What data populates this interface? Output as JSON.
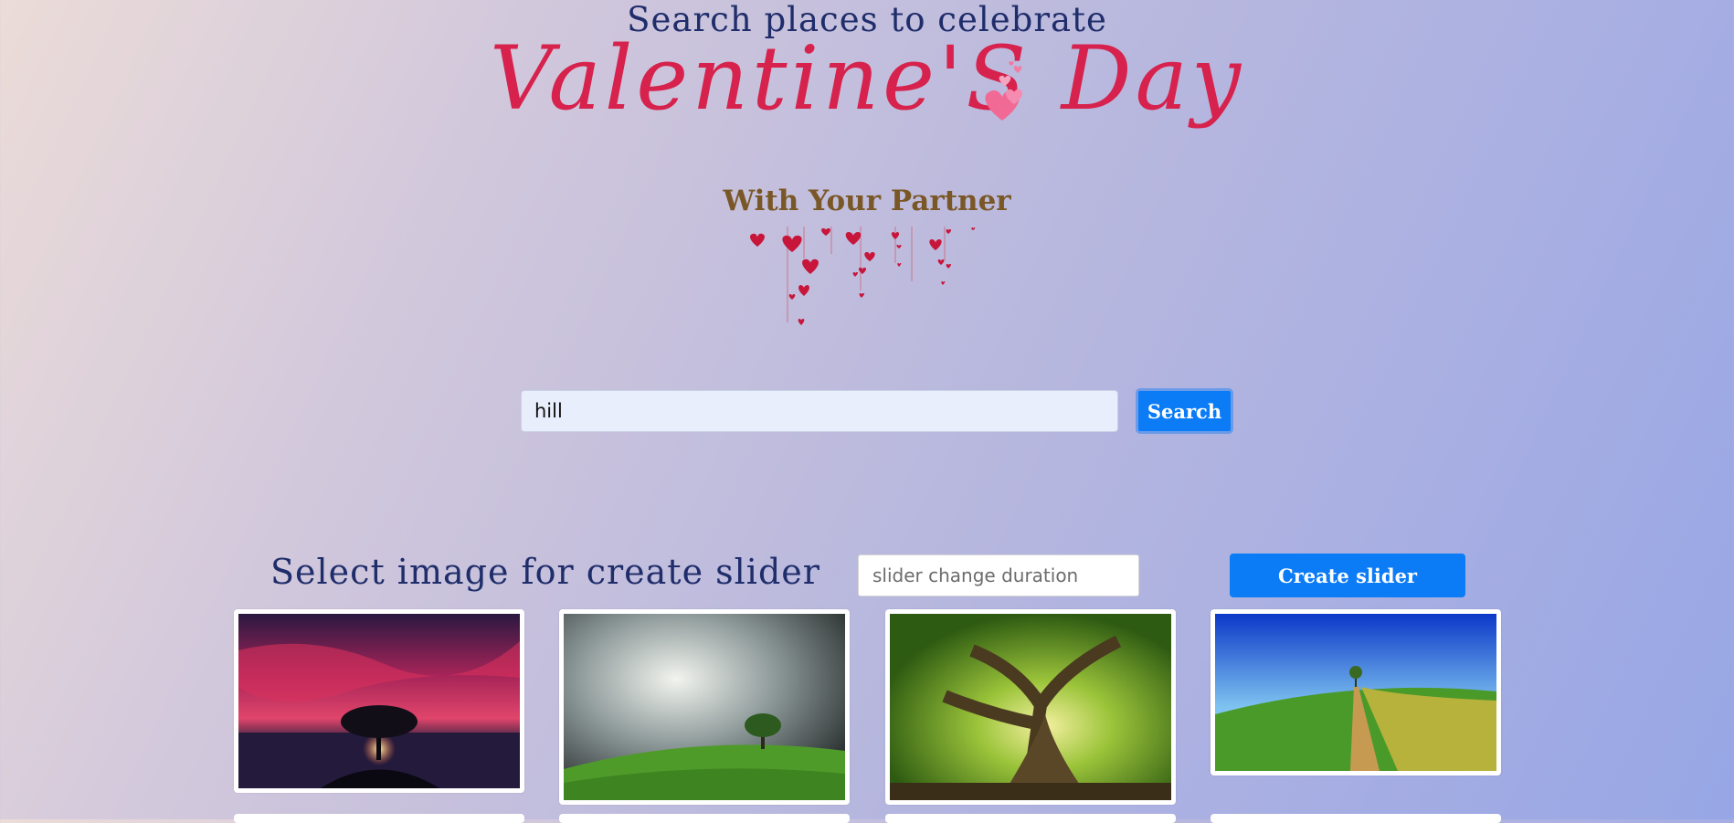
{
  "header": {
    "search_heading": "Search places to celebrate",
    "script_title": "Valentine'S Day",
    "subtitle": "With Your Partner"
  },
  "search": {
    "value": "hill",
    "button_label": "Search"
  },
  "slider": {
    "title": "Select image for create slider",
    "duration_placeholder": "slider change duration",
    "create_label": "Create slider"
  },
  "gallery": {
    "images": [
      {
        "name": "red-sky-tree-sunset"
      },
      {
        "name": "stormy-sky-green-hill-tree"
      },
      {
        "name": "big-old-tree-forest"
      },
      {
        "name": "blue-sky-dirt-road-hill"
      }
    ]
  },
  "colors": {
    "accent": "#0b7cf6",
    "heading": "#1f2d6b",
    "script": "#d6224c",
    "subtitle": "#7a5726"
  }
}
